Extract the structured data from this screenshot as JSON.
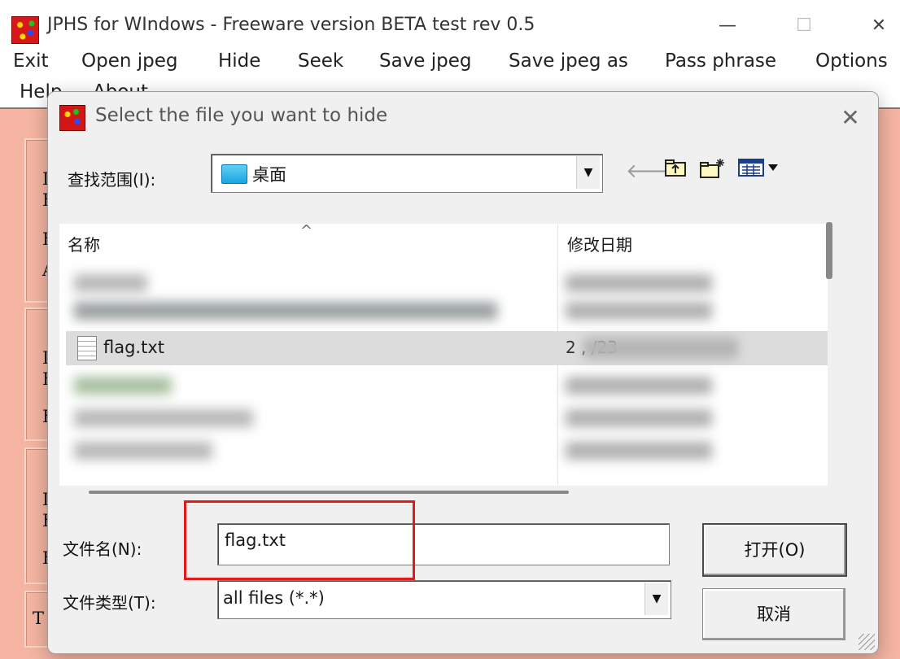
{
  "app": {
    "title": "JPHS for WIndows - Freeware version BETA test rev 0.5",
    "controls": {
      "minimize": "—",
      "maximize": "☐",
      "close": "✕"
    },
    "menu": [
      "Exit",
      "Open jpeg",
      "Hide",
      "Seek",
      "Save jpeg",
      "Save jpeg as",
      "Pass phrase",
      "Options",
      "Help",
      "About"
    ],
    "background_letters": [
      "I",
      "F",
      "F",
      "A",
      "I",
      "F",
      "F",
      "I",
      "F",
      "F",
      "T"
    ],
    "body_color": "#f5b5a2"
  },
  "dialog": {
    "title": "Select the file you want to hide",
    "close": "✕",
    "look_in_label": "查找范围(I):",
    "look_in_value": "桌面",
    "toolbar_icons": [
      "back-arrow-icon",
      "up-folder-icon",
      "new-folder-icon",
      "view-menu-icon"
    ],
    "columns": {
      "name": "名称",
      "date": "修改日期"
    },
    "selected_file": {
      "name": "flag.txt",
      "date_partial": "2   ,   /23"
    },
    "file_name_label": "文件名(N):",
    "file_name_value": "flag.txt",
    "file_type_label": "文件类型(T):",
    "file_type_value": "all files (*.*)",
    "open_button": "打开(O)",
    "cancel_button": "取消",
    "highlight_color": "#e21a1a"
  }
}
